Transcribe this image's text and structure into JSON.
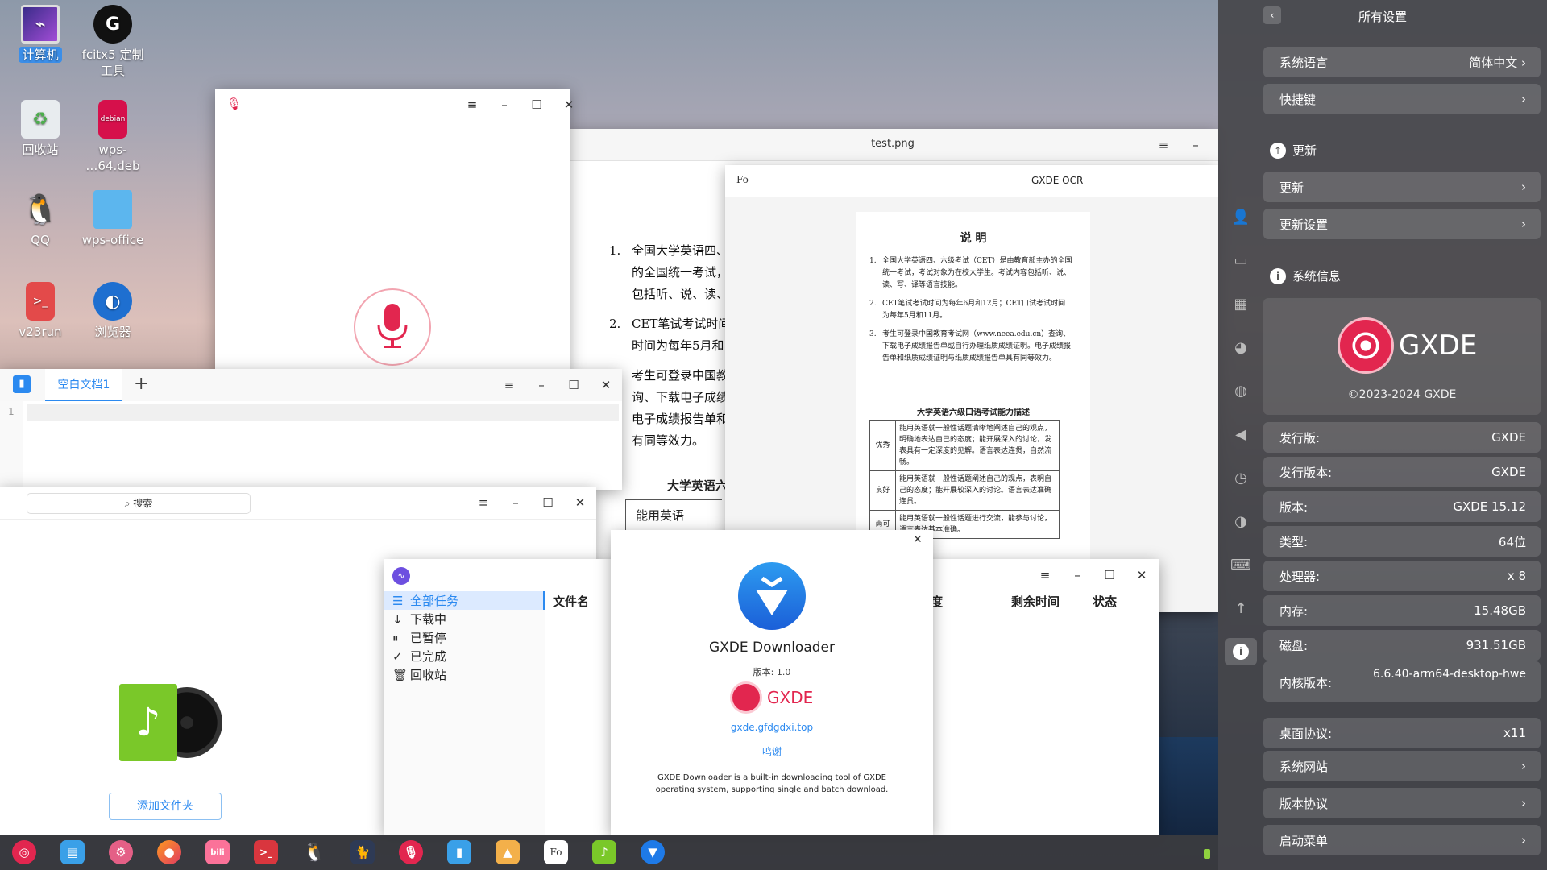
{
  "desktop": {
    "icons": [
      {
        "label": "计算机",
        "selected": true
      },
      {
        "label": "fcitx5 定制\n工具"
      },
      {
        "label": "回收站"
      },
      {
        "label": "wps-\n…64.deb"
      },
      {
        "label": "QQ"
      },
      {
        "label": "wps-office"
      },
      {
        "label": "v23run"
      },
      {
        "label": "浏览器"
      }
    ],
    "deb_badge": "debian"
  },
  "image_viewer": {
    "title": "test.png",
    "paragraphs": [
      {
        "num": "1.",
        "lines": [
          "全国大学英语四、",
          "的全国统一考试，",
          "包括听、说、读、"
        ]
      },
      {
        "num": "2.",
        "lines": [
          "CET笔试考试时间",
          "时间为每年5月和"
        ]
      },
      {
        "num": "",
        "lines": [
          "考生可登录中国教",
          "询、下载电子成绩",
          "电子成绩报告单和",
          "有同等效力。"
        ]
      }
    ],
    "heading": "大学英语六",
    "cell": "能用英语"
  },
  "ocr": {
    "title": "GXDE OCR",
    "logo": "Fo",
    "doc_title": "说  明",
    "items": [
      {
        "num": "1.",
        "text": "全国大学英语四、六级考试（CET）是由教育部主办的全国统一考试，考试对象为在校大学生。考试内容包括听、说、读、写、译等语言技能。"
      },
      {
        "num": "2.",
        "text": "CET笔试考试时间为每年6月和12月；CET口试考试时间为每年5月和11月。"
      },
      {
        "num": "3.",
        "text": "考生可登录中国教育考试网（www.neea.edu.cn）查询、下载电子成绩报告单或自行办理纸质成绩证明。电子成绩报告单和纸质成绩证明与纸质成绩报告单具有同等效力。"
      }
    ],
    "table_title": "大学英语六级口语考试能力描述",
    "rows": [
      {
        "grade": "优秀",
        "desc": "能用英语就一般性话题清晰地阐述自己的观点，明确地表达自己的态度；能开展深入的讨论，发表具有一定深度的见解。语言表达连贯，自然流畅。"
      },
      {
        "grade": "良好",
        "desc": "能用英语就一般性话题阐述自己的观点，表明自己的态度；能开展较深入的讨论。语言表达准确连贯。"
      },
      {
        "grade": "尚可",
        "desc": "能用英语就一般性话题进行交流，能参与讨论，语言表达基本准确。"
      }
    ]
  },
  "editor": {
    "tab": "空白文档1",
    "add": "+",
    "line": "1"
  },
  "music": {
    "search_placeholder": "搜索",
    "add_folder": "添加文件夹"
  },
  "downloader": {
    "nav": [
      "全部任务",
      "下载中",
      "已暂停",
      "已完成",
      "回收站"
    ],
    "nav_icons": [
      "list-icon",
      "arrow-down-icon",
      "pause-icon",
      "check-icon",
      "trash-icon"
    ],
    "cols": {
      "name": "文件名",
      "progress": "度",
      "remaining": "剩余时间",
      "status": "状态"
    }
  },
  "about": {
    "app": "GXDE Downloader",
    "version": "版本: 1.0",
    "brand": "GXDE",
    "site": "gxde.gfdgdxi.top",
    "thanks": "鸣谢",
    "desc": "GXDE Downloader is a built-in downloading tool of GXDE operating system, supporting single and batch download."
  },
  "settings": {
    "title": "所有设置",
    "language": {
      "label": "系统语言",
      "value": "简体中文"
    },
    "shortcuts": "快捷键",
    "update_section": "更新",
    "update": "更新",
    "update_settings": "更新设置",
    "sysinfo_section": "系统信息",
    "brand": "GXDE",
    "copyright": "©2023-2024 GXDE",
    "info": [
      {
        "k": "发行版:",
        "v": "GXDE"
      },
      {
        "k": "发行版本:",
        "v": "GXDE"
      },
      {
        "k": "版本:",
        "v": "GXDE 15.12"
      },
      {
        "k": "类型:",
        "v": "64位"
      },
      {
        "k": "处理器:",
        "v": "x 8"
      },
      {
        "k": "内存:",
        "v": "15.48GB"
      },
      {
        "k": "磁盘:",
        "v": "931.51GB"
      }
    ],
    "kernel": {
      "k": "内核版本:",
      "v": "6.6.40-arm64-desktop-hwe"
    },
    "protocol": {
      "k": "桌面协议:",
      "v": "x11"
    },
    "links": [
      "系统网站",
      "版本协议",
      "启动菜单"
    ]
  },
  "colors": {
    "accent": "#2c8af0",
    "brand": "#e2264f"
  }
}
